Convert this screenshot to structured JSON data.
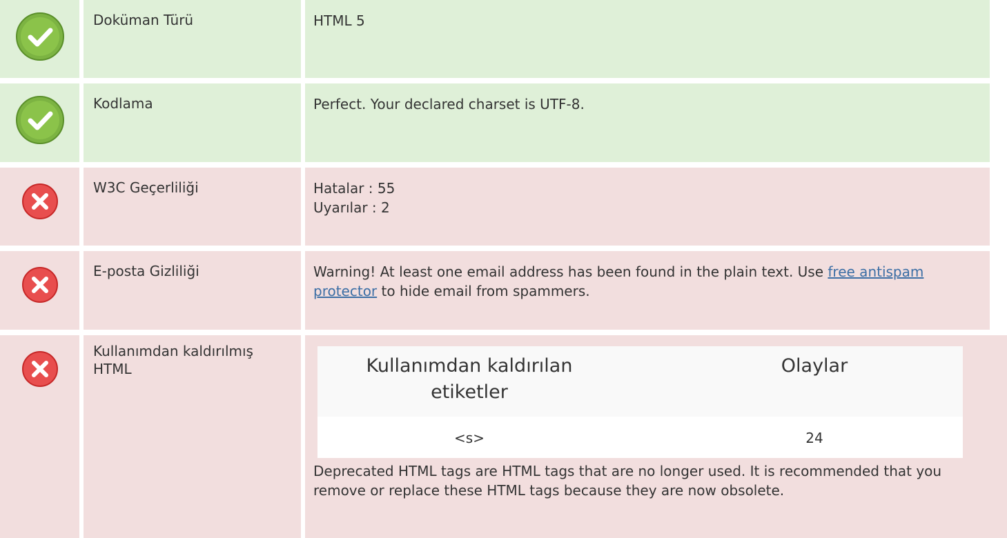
{
  "colors": {
    "ok_bg": "#dff0d8",
    "bad_bg": "#f2dede",
    "link": "#3b6ea5"
  },
  "rows": [
    {
      "status": "ok",
      "icon": "check-circle-icon",
      "label": "Doküman Türü",
      "value": "HTML 5"
    },
    {
      "status": "ok",
      "icon": "check-circle-icon",
      "label": "Kodlama",
      "value": "Perfect. Your declared charset is UTF-8."
    },
    {
      "status": "bad",
      "icon": "error-x-icon",
      "label": "W3C Geçerliliği",
      "lines": [
        "Hatalar : 55",
        "Uyarılar : 2"
      ]
    },
    {
      "status": "bad",
      "icon": "error-x-icon",
      "label": "E-posta Gizliliği",
      "text_before": "Warning! At least one email address has been found in the plain text. Use ",
      "link_text": "free antispam protector",
      "text_after": " to hide email from spammers."
    },
    {
      "status": "bad",
      "icon": "error-x-icon",
      "label": "Kullanımdan kaldırılmış HTML",
      "table": {
        "headers": [
          "Kullanımdan kaldırılan etiketler",
          "Olaylar"
        ],
        "rows": [
          [
            "<s>",
            "24"
          ]
        ]
      },
      "note": "Deprecated HTML tags are HTML tags that are no longer used. It is recommended that you remove or replace these HTML tags because they are now obsolete."
    }
  ]
}
